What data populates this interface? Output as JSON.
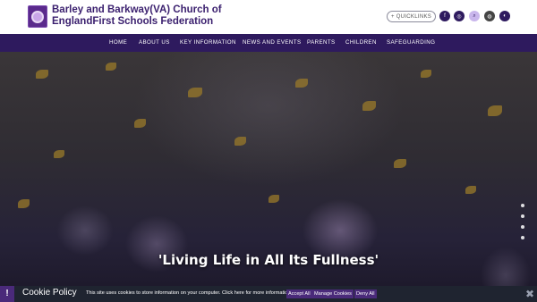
{
  "header": {
    "school_name": "Barley and Barkway(VA) Church of EnglandFirst Schools Federation",
    "quicklinks_label": "+ QUICKLINKS",
    "social_icons": [
      "facebook-icon",
      "instagram-icon",
      "search-icon",
      "translate-icon",
      "accessibility-icon"
    ]
  },
  "nav": {
    "items": [
      {
        "label": "HOME"
      },
      {
        "label": "ABOUT US"
      },
      {
        "label": "KEY INFORMATION"
      },
      {
        "label": "NEWS AND EVENTS"
      },
      {
        "label": "PARENTS"
      },
      {
        "label": "CHILDREN"
      },
      {
        "label": "SAFEGUARDING"
      }
    ]
  },
  "hero": {
    "caption": "'Living Life in All Its Fullness'",
    "slide_count": 4,
    "active_slide": 1
  },
  "cookie": {
    "title": "Cookie Policy",
    "text": "This site uses cookies to store information on your computer. Click here for more information",
    "accept_label": "Accept All",
    "manage_label": "Manage Cookies",
    "deny_label": "Deny All",
    "close_glyph": "✖",
    "alert_glyph": "!"
  },
  "colors": {
    "brand_purple": "#2e1a5e",
    "accent_lilac": "#c9b6ec",
    "cookie_bar": "#1f2430",
    "cookie_button": "#4a2a7a"
  }
}
